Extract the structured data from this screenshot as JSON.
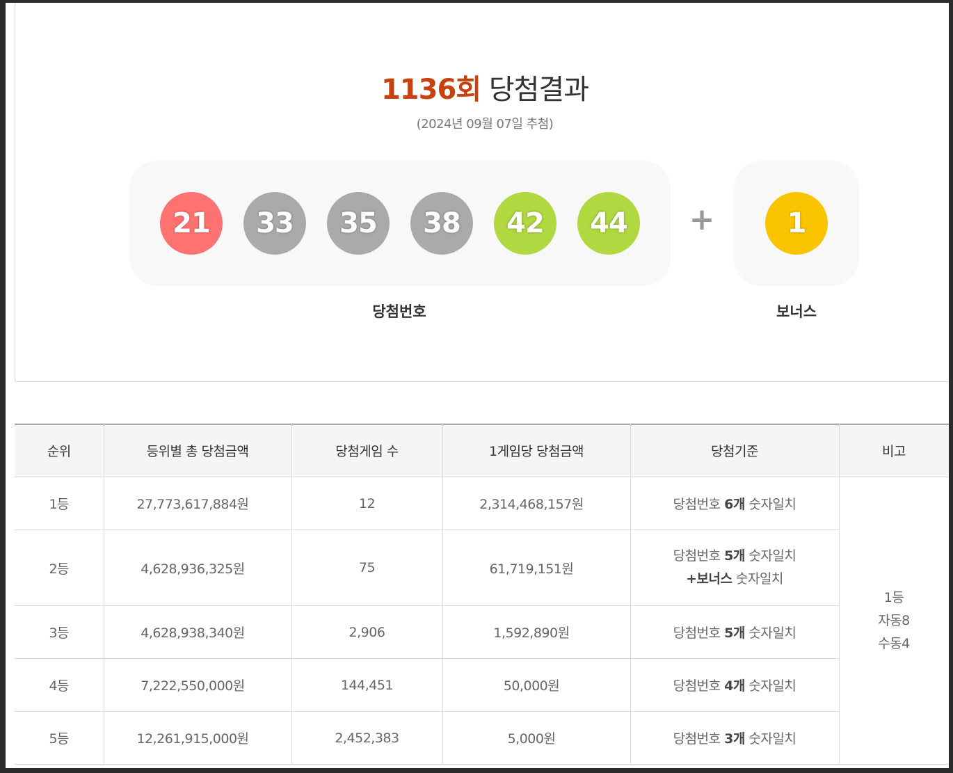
{
  "header": {
    "round": "1136회",
    "title_suffix": "당첨결과",
    "draw_date": "(2024년 09월 07일 추첨)"
  },
  "winning_numbers": [
    {
      "num": "21",
      "color": "#ff7272"
    },
    {
      "num": "33",
      "color": "#aaaaaa"
    },
    {
      "num": "35",
      "color": "#aaaaaa"
    },
    {
      "num": "38",
      "color": "#aaaaaa"
    },
    {
      "num": "42",
      "color": "#b0d840"
    },
    {
      "num": "44",
      "color": "#b0d840"
    }
  ],
  "bonus": {
    "num": "1",
    "color": "#fbc400"
  },
  "plus_symbol": "+",
  "labels": {
    "winning": "당첨번호",
    "bonus": "보너스"
  },
  "table": {
    "headers": [
      "순위",
      "등위별 총 당첨금액",
      "당첨게임 수",
      "1게임당 당첨금액",
      "당첨기준",
      "비고"
    ],
    "rows": [
      {
        "rank": "1등",
        "total": "27,773,617,884원",
        "count": "12",
        "per_game": "2,314,468,157원",
        "crit_pre": "당첨번호 ",
        "crit_bold": "6개",
        "crit_post": " 숫자일치"
      },
      {
        "rank": "2등",
        "total": "4,628,936,325원",
        "count": "75",
        "per_game": "61,719,151원",
        "crit_pre": "당첨번호 ",
        "crit_bold": "5개",
        "crit_post": " 숫자일치",
        "crit2_bold": "+보너스",
        "crit2_post": " 숫자일치"
      },
      {
        "rank": "3등",
        "total": "4,628,938,340원",
        "count": "2,906",
        "per_game": "1,592,890원",
        "crit_pre": "당첨번호 ",
        "crit_bold": "5개",
        "crit_post": " 숫자일치"
      },
      {
        "rank": "4등",
        "total": "7,222,550,000원",
        "count": "144,451",
        "per_game": "50,000원",
        "crit_pre": "당첨번호 ",
        "crit_bold": "4개",
        "crit_post": " 숫자일치"
      },
      {
        "rank": "5등",
        "total": "12,261,915,000원",
        "count": "2,452,383",
        "per_game": "5,000원",
        "crit_pre": "당첨번호 ",
        "crit_bold": "3개",
        "crit_post": " 숫자일치"
      }
    ],
    "note": [
      "1등",
      "자동8",
      "수동4"
    ]
  }
}
